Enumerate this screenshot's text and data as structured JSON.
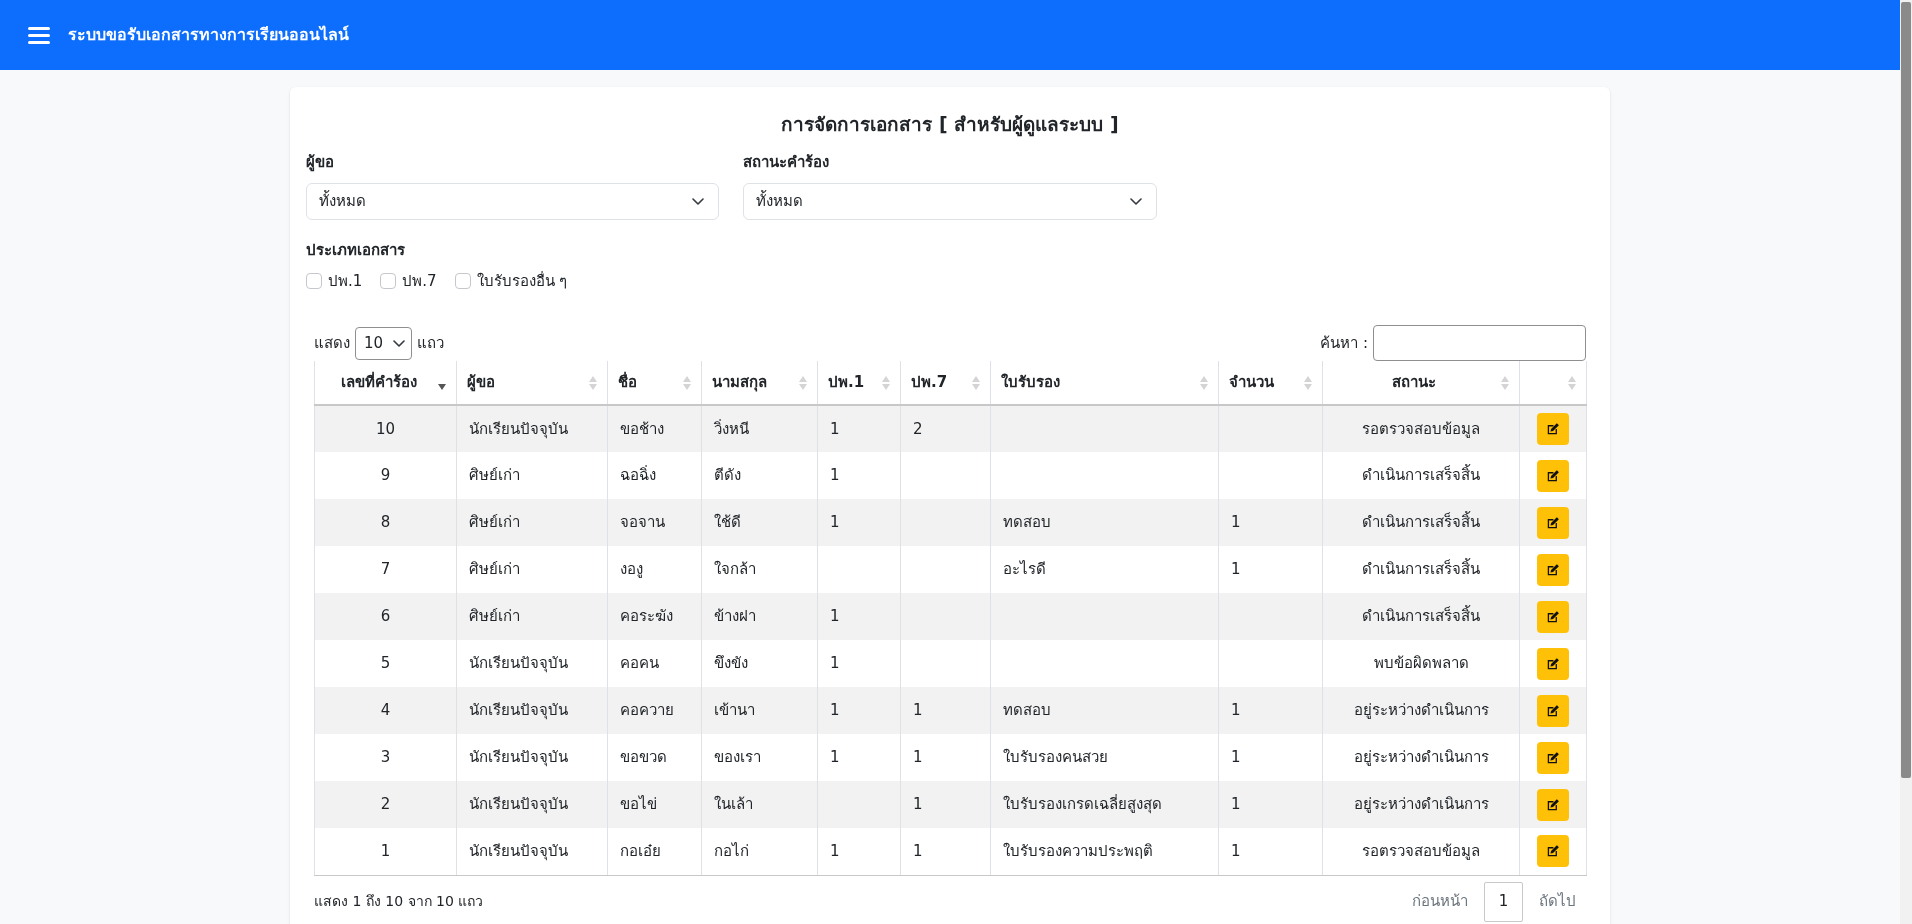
{
  "navbar": {
    "title": "ระบบขอรับเอกสารทางการเรียนออนไลน์"
  },
  "page_title": "การจัดการเอกสาร [ สำหรับผู้ดูแลระบบ ]",
  "filters": [
    {
      "label": "ผู้ขอ",
      "value": "ทั้งหมด"
    },
    {
      "label": "สถานะคำร้อง",
      "value": "ทั้งหมด"
    }
  ],
  "document_types": {
    "label": "ประเภทเอกสาร",
    "options": [
      {
        "label": "ปพ.1",
        "checked": false
      },
      {
        "label": "ปพ.7",
        "checked": false
      },
      {
        "label": "ใบรับรองอื่น ๆ",
        "checked": false
      }
    ]
  },
  "table_controls": {
    "show_label": "แสดง",
    "page_length": "10",
    "rows_label": "แถว",
    "search_label": "ค้นหา :"
  },
  "table": {
    "columns": [
      {
        "label": "เลขที่คำร้อง",
        "sorted": true
      },
      {
        "label": "ผู้ขอ",
        "sorted": false
      },
      {
        "label": "ชื่อ",
        "sorted": false
      },
      {
        "label": "นามสกุล",
        "sorted": false
      },
      {
        "label": "ปพ.1",
        "sorted": false
      },
      {
        "label": "ปพ.7",
        "sorted": false
      },
      {
        "label": "ใบรับรอง",
        "sorted": false
      },
      {
        "label": "จำนวน",
        "sorted": false
      },
      {
        "label": "สถานะ",
        "sorted": false
      },
      {
        "sorted": false
      }
    ],
    "rows": [
      {
        "request_no": "10",
        "requester": "นักเรียนปัจจุบัน",
        "first_name": "ขอช้าง",
        "last_name": "วิ่งหนี",
        "pp1": "1",
        "pp7": "2",
        "status": "รอตรวจสอบข้อมูล"
      },
      {
        "request_no": "9",
        "requester": "ศิษย์เก่า",
        "first_name": "ฉอฉิ่ง",
        "last_name": "ตีดัง",
        "pp1": "1",
        "status": "ดำเนินการเสร็จสิ้น"
      },
      {
        "request_no": "8",
        "requester": "ศิษย์เก่า",
        "first_name": "จอจาน",
        "last_name": "ใช้ดี",
        "pp1": "1",
        "certificate": "ทดสอบ",
        "quantity": "1",
        "status": "ดำเนินการเสร็จสิ้น"
      },
      {
        "request_no": "7",
        "requester": "ศิษย์เก่า",
        "first_name": "งองู",
        "last_name": "ใจกล้า",
        "certificate": "อะไรดี",
        "quantity": "1",
        "status": "ดำเนินการเสร็จสิ้น"
      },
      {
        "request_no": "6",
        "requester": "ศิษย์เก่า",
        "first_name": "คอระฆัง",
        "last_name": "ข้างฝา",
        "pp1": "1",
        "status": "ดำเนินการเสร็จสิ้น"
      },
      {
        "request_no": "5",
        "requester": "นักเรียนปัจจุบัน",
        "first_name": "คอคน",
        "last_name": "ขึงขัง",
        "pp1": "1",
        "status": "พบข้อผิดพลาด"
      },
      {
        "request_no": "4",
        "requester": "นักเรียนปัจจุบัน",
        "first_name": "คอควาย",
        "last_name": "เข้านา",
        "pp1": "1",
        "pp7": "1",
        "certificate": "ทดสอบ",
        "quantity": "1",
        "status": "อยู่ระหว่างดำเนินการ"
      },
      {
        "request_no": "3",
        "requester": "นักเรียนปัจจุบัน",
        "first_name": "ขอขวด",
        "last_name": "ของเรา",
        "pp1": "1",
        "pp7": "1",
        "certificate": "ใบรับรองคนสวย",
        "quantity": "1",
        "status": "อยู่ระหว่างดำเนินการ"
      },
      {
        "request_no": "2",
        "requester": "นักเรียนปัจจุบัน",
        "first_name": "ขอไข่",
        "last_name": "ในเล้า",
        "pp7": "1",
        "certificate": "ใบรับรองเกรดเฉลี่ยสูงสุด",
        "quantity": "1",
        "status": "อยู่ระหว่างดำเนินการ"
      },
      {
        "request_no": "1",
        "requester": "นักเรียนปัจจุบัน",
        "first_name": "กอเอ๋ย",
        "last_name": "กอไก่",
        "pp1": "1",
        "pp7": "1",
        "certificate": "ใบรับรองความประพฤติ",
        "quantity": "1",
        "status": "รอตรวจสอบข้อมูล"
      }
    ]
  },
  "footer": {
    "info": "แสดง 1 ถึง 10 จาก 10 แถว",
    "pagination": {
      "previous": {
        "label": "ก่อนหน้า",
        "disabled": true
      },
      "pages": [
        {
          "label": "1",
          "selected": true
        }
      ],
      "next": {
        "label": "ถัดไป",
        "disabled": true
      }
    }
  }
}
